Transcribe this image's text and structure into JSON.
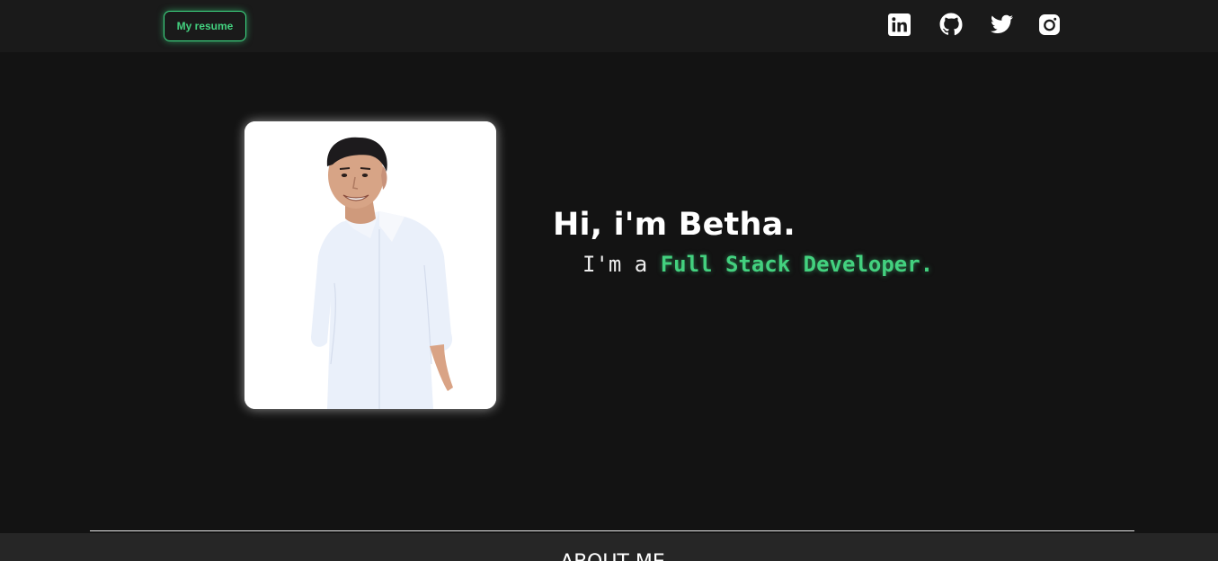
{
  "navbar": {
    "resume_label": "My resume",
    "social_links": [
      {
        "name": "linkedin-icon"
      },
      {
        "name": "github-icon"
      },
      {
        "name": "twitter-icon"
      },
      {
        "name": "instagram-icon"
      }
    ]
  },
  "hero": {
    "greeting": "Hi, i'm Betha.",
    "tagline_prefix": "I'm a ",
    "tagline_role": "Full Stack Developer.",
    "photo": "profile-photo"
  },
  "about": {
    "title": "ABOUT ME"
  },
  "colors": {
    "background": "#131313",
    "navbar": "#1a1a1a",
    "accent": "#43d17f",
    "text": "#ffffff",
    "about_bg": "#262626"
  }
}
